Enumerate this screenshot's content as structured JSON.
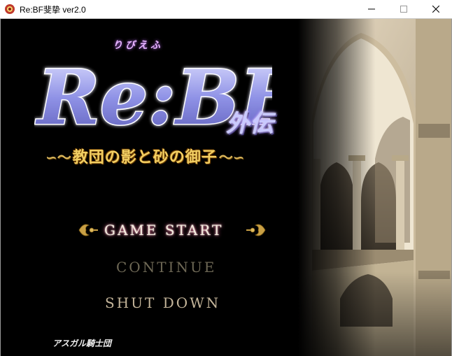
{
  "window": {
    "title": "Re:BF斐挚 ver2.0",
    "icon": "game-app-icon",
    "controls": [
      "minimize-icon",
      "maximize-icon",
      "close-icon"
    ]
  },
  "logo": {
    "main": "Re:BF",
    "ruby": "りびえふ",
    "suffix": "外伝",
    "subtitle_left": "∽〜",
    "subtitle": "教団の影と砂の御子",
    "subtitle_right": "〜∽"
  },
  "menu": {
    "items": [
      {
        "label": "GAME START",
        "state": "selected"
      },
      {
        "label": "CONTINUE",
        "state": "disabled"
      },
      {
        "label": "SHUT DOWN",
        "state": "normal"
      }
    ]
  },
  "footer": {
    "company": "アスガル騎士団"
  },
  "colors": {
    "selected_text": "#f3ecdd",
    "disabled_text": "#6e6855",
    "normal_text": "#c4b59a",
    "subtitle_gold": "#f2cf63",
    "ornament_gold": "#c9a045"
  }
}
